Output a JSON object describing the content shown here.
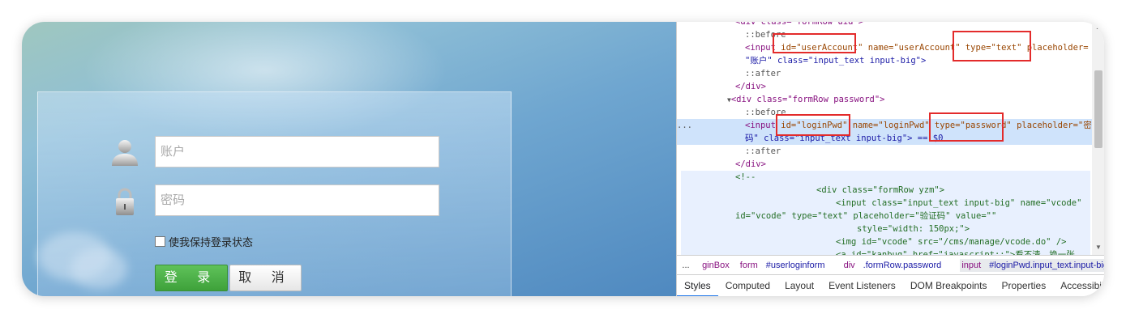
{
  "login": {
    "username_placeholder": "账户",
    "password_placeholder": "密码",
    "remember_label": "使我保持登录状态",
    "login_button": "登 录",
    "cancel_button": "取 消",
    "icons": [
      "user-icon",
      "lock-icon"
    ]
  },
  "devtools": {
    "code_lines": {
      "l0": "<div class=\"formRow uid\">",
      "l1": "::before",
      "l2a": "<input ",
      "l2b": "id=\"userAccount\"",
      "l2c": " name=\"userAccount\" ",
      "l2d": "type=\"text\"",
      "l2e": " placeholder=",
      "l3": "\"账户\" class=\"input_text input-big\">",
      "l4": "::after",
      "l5": "</div>",
      "l6": "<div class=\"formRow password\">",
      "l7": "::before",
      "l8a": "<input ",
      "l8b": "id=\"loginPwd\"",
      "l8c": " name=\"loginPwd\" ",
      "l8d": "type=\"password\"",
      "l8e": " placeholder=\"密",
      "l9": "码\" class=\"input_text input-big\"> == $0",
      "l10": "::after",
      "l11": "</div>",
      "l12": "<!--",
      "l13": "<div class=\"formRow yzm\">",
      "l14": "<input class=\"input_text input-big\" name=\"vcode\"",
      "l15": "id=\"vcode\" type=\"text\" placeholder=\"验证码\" value=\"\"",
      "l16": "style=\"width: 150px;\">",
      "l17": "<img id=\"vcode\" src=\"/cms/manage/vcode.do\" />",
      "l18": "<a id=\"kanbuq\" href=\"javascript:;\">看不清，换一张"
    },
    "gutter_dots": "...",
    "breadcrumb": {
      "more": "...",
      "c1": "ginBox",
      "c2_tag": "form",
      "c2_rest": "#userloginform",
      "c3_tag": "div",
      "c3_rest": ".formRow.password",
      "c4_tag": "input",
      "c4_rest": "#loginPwd.input_text.input-big",
      "c5": "..."
    },
    "tabs": [
      "Styles",
      "Computed",
      "Layout",
      "Event Listeners",
      "DOM Breakpoints",
      "Properties",
      "Accessibility"
    ],
    "active_tab": "Styles"
  },
  "colors": {
    "highlight_box": "#e32b2b",
    "login_green": "#4cb148",
    "selection": "#cfe3fb"
  }
}
